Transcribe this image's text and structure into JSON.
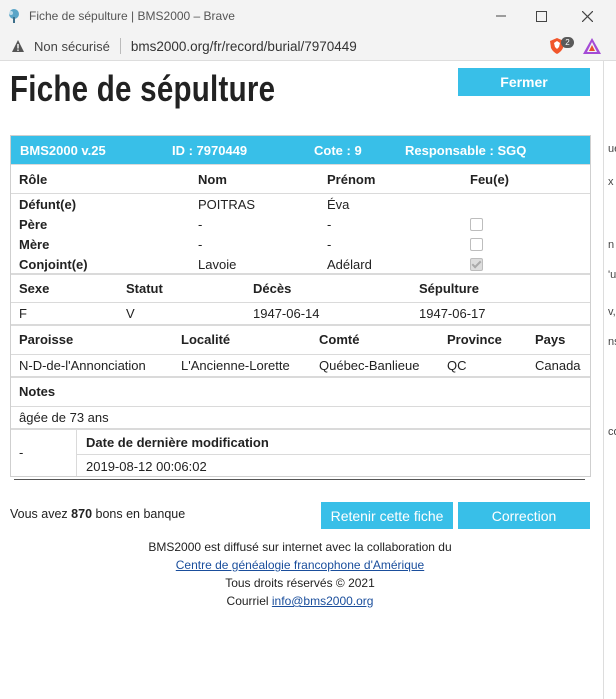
{
  "window": {
    "title": "Fiche de sépulture | BMS2000 – Brave",
    "minimize": "—",
    "maximize": "☐",
    "close": "✕"
  },
  "address": {
    "security_label": "Non sécurisé",
    "url": "bms2000.org/fr/record/burial/7970449",
    "shield_count": "2"
  },
  "page": {
    "title": "Fiche de sépulture",
    "close_button": "Fermer"
  },
  "record": {
    "header": {
      "version": "BMS2000 v.25",
      "id": "ID : 7970449",
      "cote": "Cote : 9",
      "responsable": "Responsable : SGQ"
    },
    "persons": {
      "headers": {
        "role": "Rôle",
        "nom": "Nom",
        "prenom": "Prénom",
        "feu": "Feu(e)"
      },
      "rows": [
        {
          "role": "Défunt(e)",
          "nom": "POITRAS",
          "prenom": "Éva",
          "feu": null
        },
        {
          "role": "Père",
          "nom": "-",
          "prenom": "-",
          "feu": false
        },
        {
          "role": "Mère",
          "nom": "-",
          "prenom": "-",
          "feu": false
        },
        {
          "role": "Conjoint(e)",
          "nom": "Lavoie",
          "prenom": "Adélard",
          "feu": true
        }
      ]
    },
    "event": {
      "headers": {
        "sexe": "Sexe",
        "statut": "Statut",
        "deces": "Décès",
        "sepulture": "Sépulture"
      },
      "values": {
        "sexe": "F",
        "statut": "V",
        "deces": "1947-06-14",
        "sepulture": "1947-06-17"
      }
    },
    "place": {
      "headers": {
        "paroisse": "Paroisse",
        "localite": "Localité",
        "comte": "Comté",
        "province": "Province",
        "pays": "Pays"
      },
      "values": {
        "paroisse": "N-D-de-l'Annonciation",
        "localite": "L'Ancienne-Lorette",
        "comte": "Québec-Banlieue",
        "province": "QC",
        "pays": "Canada"
      }
    },
    "notes": {
      "label": "Notes",
      "text": "âgée de 73 ans"
    },
    "modification": {
      "left": "-",
      "label": "Date de dernière modification",
      "date": "2019-08-12 00:06:02"
    }
  },
  "bank": {
    "prefix": "Vous avez",
    "amount": "870",
    "suffix": "bons en banque"
  },
  "actions": {
    "retain": "Retenir cette fiche",
    "correction": "Correction"
  },
  "footer": {
    "line1": "BMS2000 est diffusé sur internet avec la collaboration du",
    "link": "Centre de généalogie francophone d'Amérique",
    "rights": "Tous droits réservés © 2021",
    "mail_prefix": "Courriel",
    "mail": "info@bms2000.org"
  },
  "background_window_fragments": [
    "ue",
    "x",
    "",
    "n",
    "'u",
    "v,",
    "ns",
    "co"
  ],
  "colors": {
    "accent": "#38bfe8",
    "link": "#1a4e9c"
  }
}
